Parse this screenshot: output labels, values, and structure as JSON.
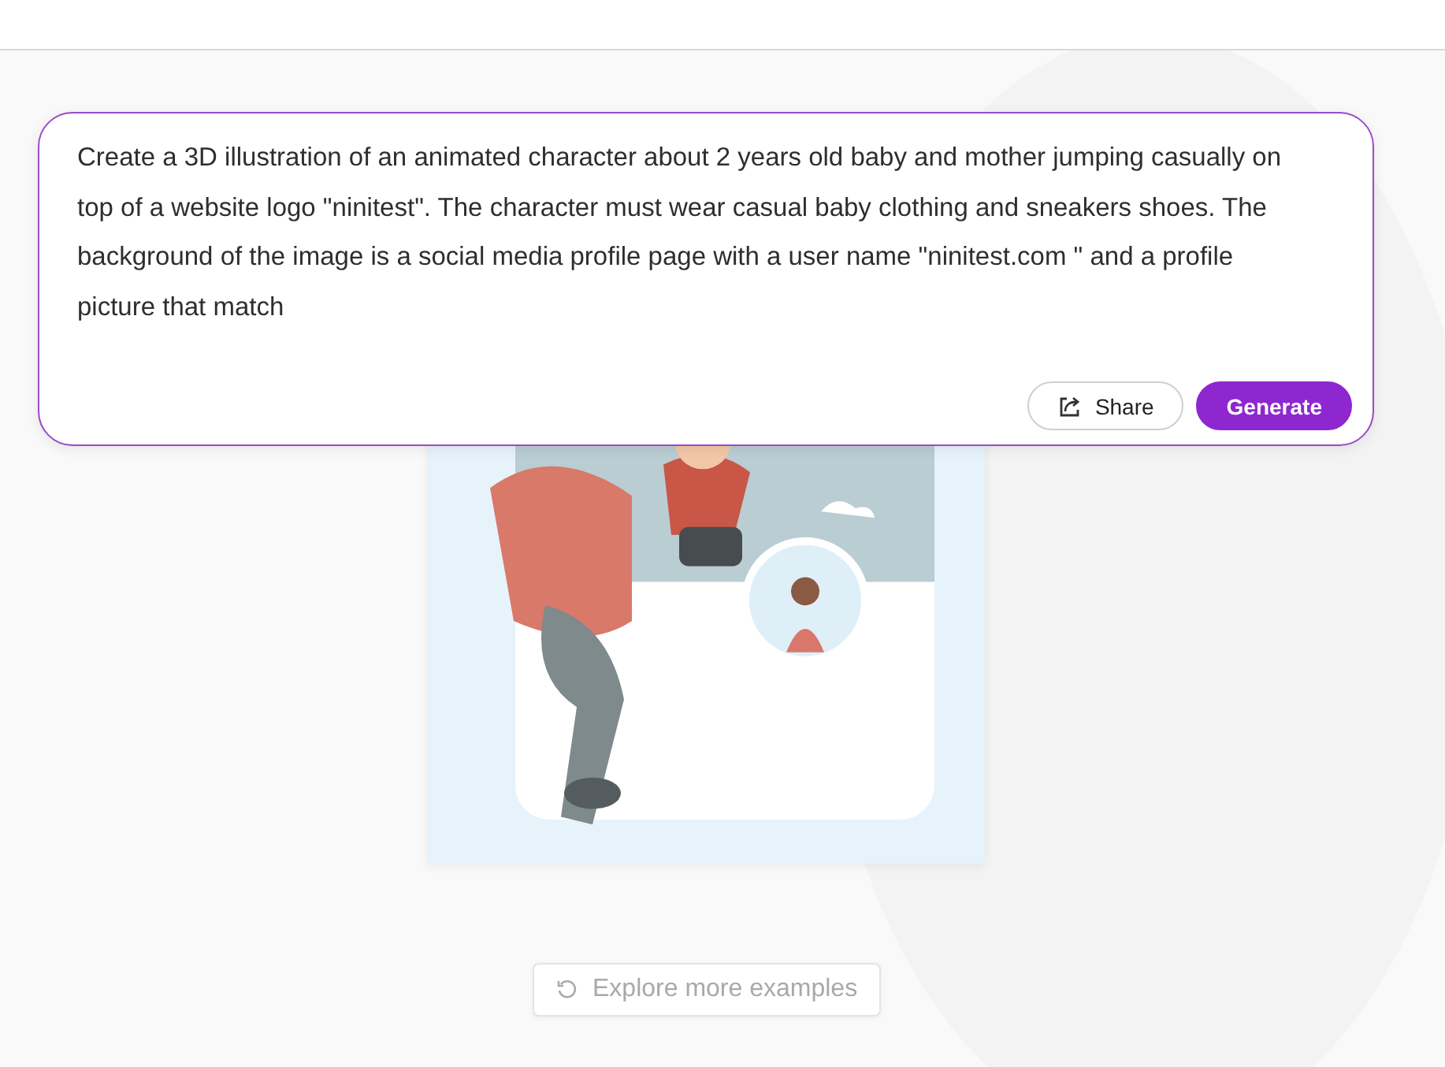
{
  "prompt": {
    "value": "Create a 3D illustration of an animated character about  2 years old baby and mother   jumping casually on top of a website  logo \"ninitest\". The character must wear casual baby  clothing and sneakers shoes. The background of the image is a social media profile page with a user name \"ninitest.com  \" and a profile picture that match"
  },
  "buttons": [
    {
      "kind": "share",
      "label": "Share"
    },
    {
      "kind": "generate",
      "label": "Generate"
    }
  ],
  "explore": {
    "label": "Explore more examples"
  }
}
